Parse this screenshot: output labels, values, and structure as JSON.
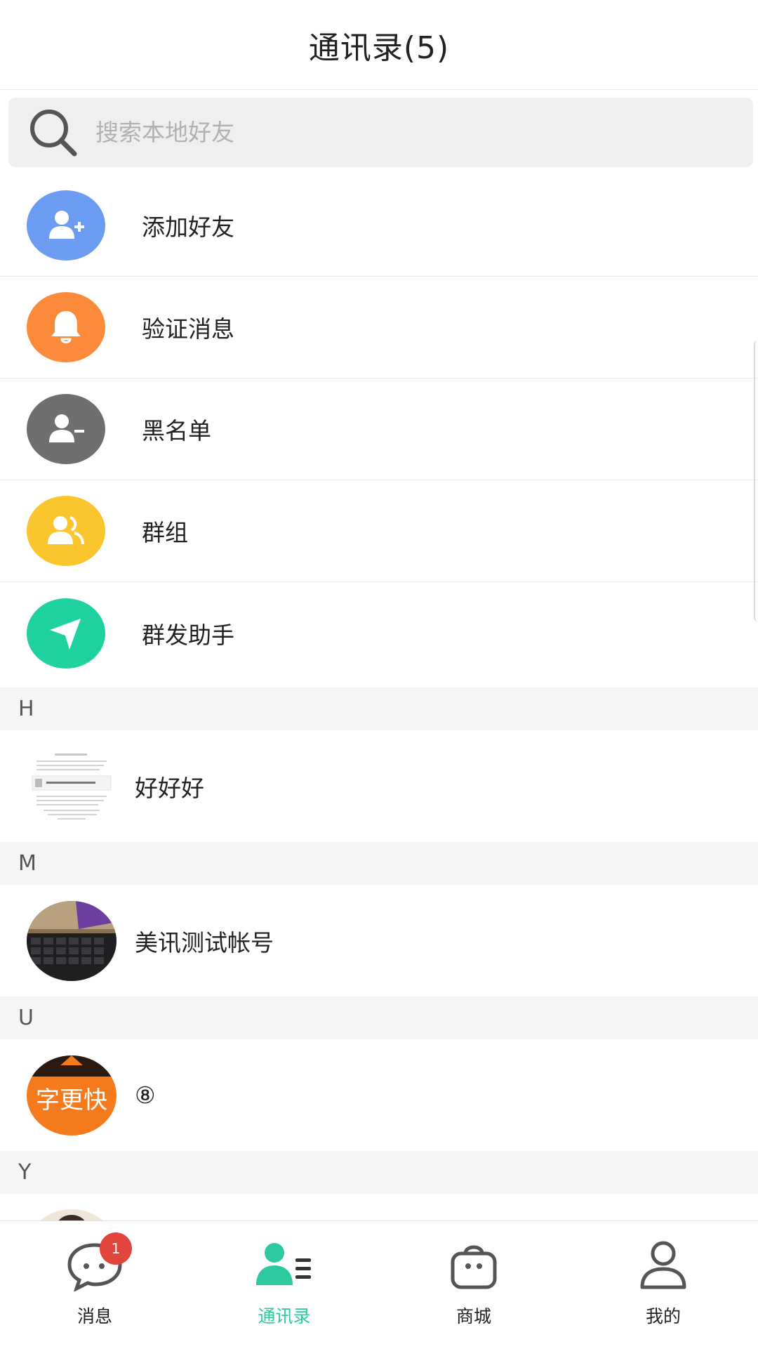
{
  "header": {
    "title": "通讯录(5)"
  },
  "search": {
    "placeholder": "搜索本地好友",
    "icon": "search-icon"
  },
  "functions": [
    {
      "label": "添加好友",
      "icon": "add-user-icon",
      "color": "#6b9cf2"
    },
    {
      "label": "验证消息",
      "icon": "bell-icon",
      "color": "#fb8b3b"
    },
    {
      "label": "黑名单",
      "icon": "remove-user-icon",
      "color": "#6f6f6f"
    },
    {
      "label": "群组",
      "icon": "group-icon",
      "color": "#fbc52d"
    },
    {
      "label": "群发助手",
      "icon": "send-icon",
      "color": "#1fd19e"
    }
  ],
  "sections": [
    {
      "letter": "H",
      "contacts": [
        {
          "name": "好好好",
          "avatar": "document-thumbnail"
        }
      ]
    },
    {
      "letter": "M",
      "contacts": [
        {
          "name": "美讯测试帐号",
          "avatar": "keyboard-photo"
        }
      ]
    },
    {
      "letter": "U",
      "contacts": [
        {
          "name": "⑧",
          "avatar_text": "字更快",
          "avatar": "orange-text-avatar"
        }
      ]
    },
    {
      "letter": "Y",
      "contacts": []
    }
  ],
  "tabbar": {
    "tabs": [
      {
        "label": "消息",
        "icon": "chat-bubble-icon",
        "badge": "1"
      },
      {
        "label": "通讯录",
        "icon": "contacts-icon",
        "active": true
      },
      {
        "label": "商城",
        "icon": "shopping-bag-icon"
      },
      {
        "label": "我的",
        "icon": "profile-icon"
      }
    ],
    "active_color": "#2dc9a0"
  }
}
